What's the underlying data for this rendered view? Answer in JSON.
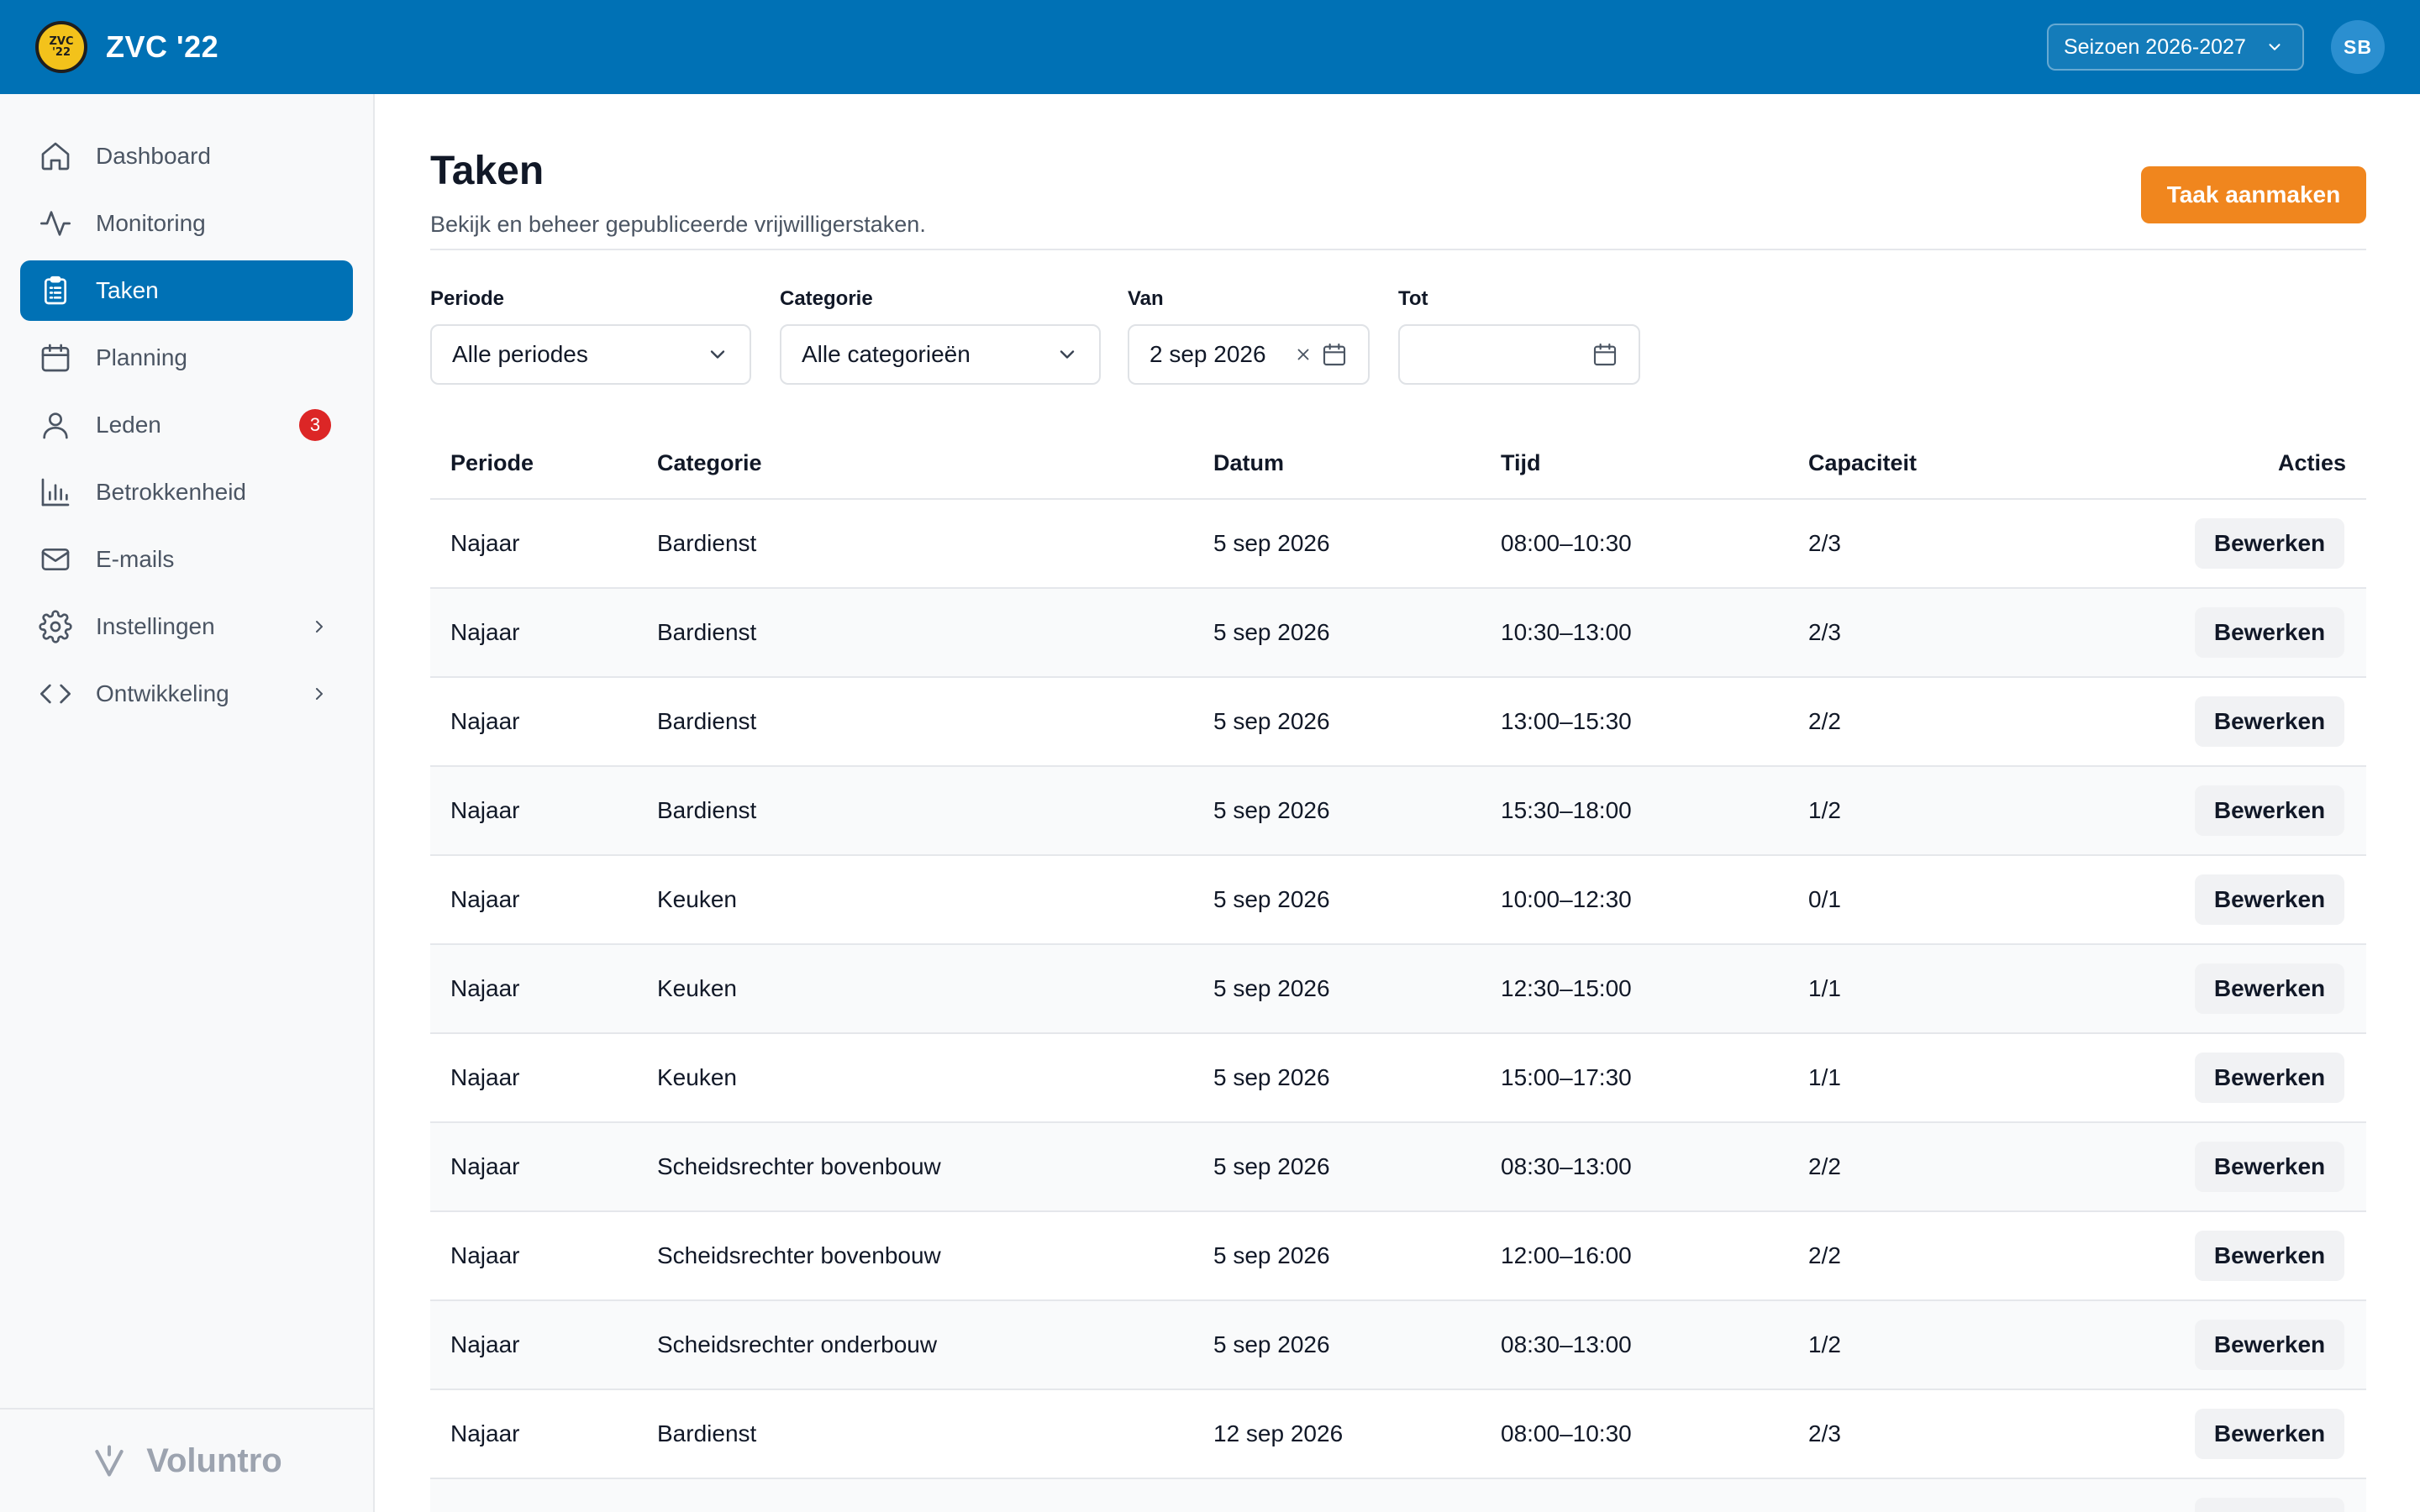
{
  "app": {
    "club_name": "ZVC '22",
    "logo_text_top": "ZVC",
    "logo_text_bottom": "'22",
    "season_label": "Seizoen 2026-2027",
    "user_initials": "SB",
    "brand_color": "#0071b5",
    "accent_color": "#f0861e"
  },
  "sidebar": {
    "items": [
      {
        "label": "Dashboard",
        "icon": "home-icon"
      },
      {
        "label": "Monitoring",
        "icon": "activity-icon"
      },
      {
        "label": "Taken",
        "icon": "clipboard-icon",
        "active": true
      },
      {
        "label": "Planning",
        "icon": "calendar-icon"
      },
      {
        "label": "Leden",
        "icon": "user-icon",
        "badge": "3"
      },
      {
        "label": "Betrokkenheid",
        "icon": "bar-chart-icon"
      },
      {
        "label": "E-mails",
        "icon": "mail-icon"
      },
      {
        "label": "Instellingen",
        "icon": "gear-icon",
        "expandable": true
      },
      {
        "label": "Ontwikkeling",
        "icon": "code-icon",
        "expandable": true
      }
    ],
    "footer_brand": "Voluntro"
  },
  "page": {
    "title": "Taken",
    "subtitle": "Bekijk en beheer gepubliceerde vrijwilligerstaken.",
    "create_button": "Taak aanmaken"
  },
  "filters": {
    "period": {
      "label": "Periode",
      "value": "Alle periodes"
    },
    "category": {
      "label": "Categorie",
      "value": "Alle categorieën"
    },
    "from": {
      "label": "Van",
      "value": "2 sep 2026"
    },
    "to": {
      "label": "Tot",
      "value": ""
    }
  },
  "table": {
    "headers": {
      "period": "Periode",
      "category": "Categorie",
      "date": "Datum",
      "time": "Tijd",
      "capacity": "Capaciteit",
      "actions": "Acties"
    },
    "edit_label": "Bewerken",
    "rows": [
      {
        "period": "Najaar",
        "category": "Bardienst",
        "date": "5 sep 2026",
        "time": "08:00–10:30",
        "capacity": "2/3"
      },
      {
        "period": "Najaar",
        "category": "Bardienst",
        "date": "5 sep 2026",
        "time": "10:30–13:00",
        "capacity": "2/3"
      },
      {
        "period": "Najaar",
        "category": "Bardienst",
        "date": "5 sep 2026",
        "time": "13:00–15:30",
        "capacity": "2/2"
      },
      {
        "period": "Najaar",
        "category": "Bardienst",
        "date": "5 sep 2026",
        "time": "15:30–18:00",
        "capacity": "1/2"
      },
      {
        "period": "Najaar",
        "category": "Keuken",
        "date": "5 sep 2026",
        "time": "10:00–12:30",
        "capacity": "0/1"
      },
      {
        "period": "Najaar",
        "category": "Keuken",
        "date": "5 sep 2026",
        "time": "12:30–15:00",
        "capacity": "1/1"
      },
      {
        "period": "Najaar",
        "category": "Keuken",
        "date": "5 sep 2026",
        "time": "15:00–17:30",
        "capacity": "1/1"
      },
      {
        "period": "Najaar",
        "category": "Scheidsrechter bovenbouw",
        "date": "5 sep 2026",
        "time": "08:30–13:00",
        "capacity": "2/2"
      },
      {
        "period": "Najaar",
        "category": "Scheidsrechter bovenbouw",
        "date": "5 sep 2026",
        "time": "12:00–16:00",
        "capacity": "2/2"
      },
      {
        "period": "Najaar",
        "category": "Scheidsrechter onderbouw",
        "date": "5 sep 2026",
        "time": "08:30–13:00",
        "capacity": "1/2"
      },
      {
        "period": "Najaar",
        "category": "Bardienst",
        "date": "12 sep 2026",
        "time": "08:00–10:30",
        "capacity": "2/3"
      },
      {
        "period": "",
        "category": "",
        "date": "",
        "time": "",
        "capacity": ""
      }
    ]
  }
}
